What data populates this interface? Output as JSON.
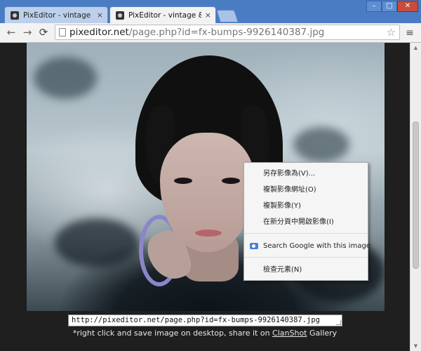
{
  "browser": {
    "tabs": [
      {
        "title": "PixEditor - vintage & retro",
        "active": false
      },
      {
        "title": "PixEditor - vintage & retro",
        "active": true
      }
    ],
    "close_glyph": "×",
    "window_controls": {
      "minimize": "–",
      "maximize": "□",
      "close": "✕"
    },
    "nav": {
      "back": "←",
      "forward": "→",
      "reload": "⟳"
    },
    "address": {
      "host": "pixeditor.net",
      "path": "/page.php?id=fx-bumps-9926140387.jpg"
    },
    "star_glyph": "☆",
    "menu_glyph": "≡"
  },
  "page": {
    "image_url_value": "http://pixeditor.net/page.php?id=fx-bumps-9926140387.jpg",
    "caption": {
      "before": "*right click and save image on desktop, share it on ",
      "link": "ClanShot",
      "after": " Gallery"
    }
  },
  "context_menu": {
    "items": [
      {
        "label": "另存影像為(V)..."
      },
      {
        "label": "複製影像網址(O)"
      },
      {
        "label": "複製影像(Y)"
      },
      {
        "label": "在新分頁中開啟影像(I)"
      },
      {
        "label": "Search Google with this image",
        "icon": "camera-icon"
      },
      {
        "label": "檢查元素(N)"
      }
    ]
  },
  "colors": {
    "titlebar": "#4a7cc4",
    "toolbar": "#f2f2f2",
    "page_bg": "#1f1f1f",
    "menu_bg": "#f5f5f5",
    "google_icon": "#4a7fd6"
  }
}
